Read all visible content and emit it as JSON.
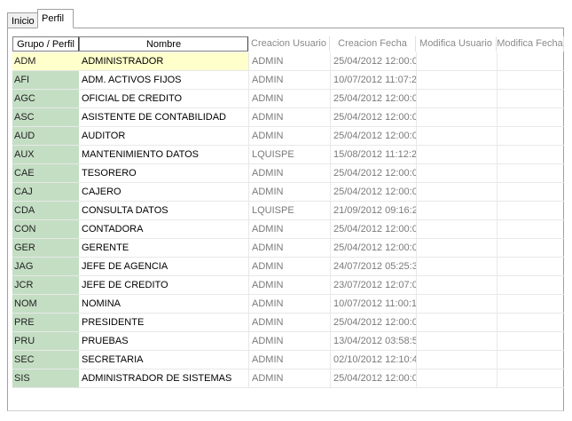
{
  "tabs": [
    {
      "label": "Inicio",
      "active": false
    },
    {
      "label": "Perfil",
      "active": true
    }
  ],
  "columns": [
    "Grupo / Perfil",
    "Nombre",
    "Creacion Usuario",
    "Creacion Fecha",
    "Modifica Usuario",
    "Modifica Fecha"
  ],
  "rows": [
    {
      "code": "ADM",
      "name": "ADMINISTRADOR",
      "user": "ADMIN",
      "date": "25/04/2012 12:00:0"
    },
    {
      "code": "AFI",
      "name": "ADM. ACTIVOS FIJOS",
      "user": "ADMIN",
      "date": "10/07/2012 11:07:2"
    },
    {
      "code": "AGC",
      "name": "OFICIAL DE CREDITO",
      "user": "ADMIN",
      "date": "25/04/2012 12:00:0"
    },
    {
      "code": "ASC",
      "name": "ASISTENTE DE CONTABILIDAD",
      "user": "ADMIN",
      "date": "25/04/2012 12:00:0"
    },
    {
      "code": "AUD",
      "name": "AUDITOR",
      "user": "ADMIN",
      "date": "25/04/2012 12:00:0"
    },
    {
      "code": "AUX",
      "name": "MANTENIMIENTO DATOS",
      "user": "LQUISPE",
      "date": "15/08/2012 11:12:2"
    },
    {
      "code": "CAE",
      "name": "TESORERO",
      "user": "ADMIN",
      "date": "25/04/2012 12:00:0"
    },
    {
      "code": "CAJ",
      "name": "CAJERO",
      "user": "ADMIN",
      "date": "25/04/2012 12:00:0"
    },
    {
      "code": "CDA",
      "name": "CONSULTA DATOS",
      "user": "LQUISPE",
      "date": "21/09/2012 09:16:2"
    },
    {
      "code": "CON",
      "name": "CONTADORA",
      "user": "ADMIN",
      "date": "25/04/2012 12:00:0"
    },
    {
      "code": "GER",
      "name": "GERENTE",
      "user": "ADMIN",
      "date": "25/04/2012 12:00:0"
    },
    {
      "code": "JAG",
      "name": "JEFE DE AGENCIA",
      "user": "ADMIN",
      "date": "24/07/2012 05:25:3"
    },
    {
      "code": "JCR",
      "name": "JEFE DE CREDITO",
      "user": "ADMIN",
      "date": "23/07/2012 12:07:0"
    },
    {
      "code": "NOM",
      "name": "NOMINA",
      "user": "ADMIN",
      "date": "10/07/2012 11:00:1"
    },
    {
      "code": "PRE",
      "name": "PRESIDENTE",
      "user": "ADMIN",
      "date": "25/04/2012 12:00:0"
    },
    {
      "code": "PRU",
      "name": "PRUEBAS",
      "user": "ADMIN",
      "date": "13/04/2012 03:58:5"
    },
    {
      "code": "SEC",
      "name": "SECRETARIA",
      "user": "ADMIN",
      "date": "02/10/2012 12:10:4"
    },
    {
      "code": "SIS",
      "name": "ADMINISTRADOR DE SISTEMAS",
      "user": "ADMIN",
      "date": "25/04/2012 12:00:0"
    }
  ],
  "colors": {
    "code_cell_bg": "#c4dec4",
    "selected_row_bg": "#ffffcc",
    "muted_text": "#7a7a7a"
  }
}
